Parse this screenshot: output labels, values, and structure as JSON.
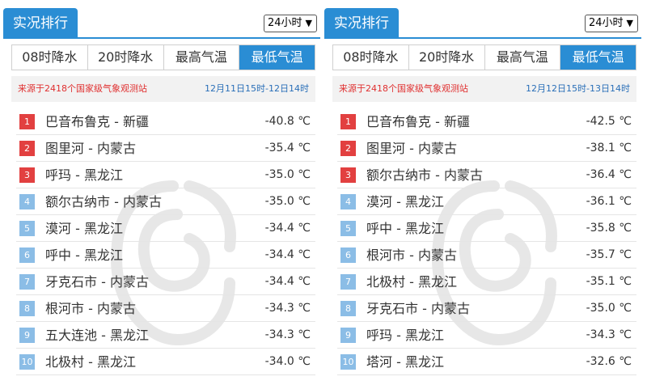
{
  "panels": [
    {
      "title": "实况排行",
      "hour_select": "24小时",
      "tabs": [
        "08时降水",
        "20时降水",
        "最高气温",
        "最低气温"
      ],
      "active_tab": 3,
      "source": "来源于2418个国家级气象观测站",
      "period": "12月11日15时-12日14时",
      "rows": [
        {
          "rank": "1",
          "station": "巴音布鲁克 - 新疆",
          "temp": "-40.8 ℃"
        },
        {
          "rank": "2",
          "station": "图里河 - 内蒙古",
          "temp": "-35.4 ℃"
        },
        {
          "rank": "3",
          "station": "呼玛 - 黑龙江",
          "temp": "-35.0 ℃"
        },
        {
          "rank": "4",
          "station": "额尔古纳市 - 内蒙古",
          "temp": "-35.0 ℃"
        },
        {
          "rank": "5",
          "station": "漠河 - 黑龙江",
          "temp": "-34.4 ℃"
        },
        {
          "rank": "6",
          "station": "呼中 - 黑龙江",
          "temp": "-34.4 ℃"
        },
        {
          "rank": "7",
          "station": "牙克石市 - 内蒙古",
          "temp": "-34.4 ℃"
        },
        {
          "rank": "8",
          "station": "根河市 - 内蒙古",
          "temp": "-34.3 ℃"
        },
        {
          "rank": "9",
          "station": "五大连池 - 黑龙江",
          "temp": "-34.3 ℃"
        },
        {
          "rank": "10",
          "station": "北极村 - 黑龙江",
          "temp": "-34.0 ℃"
        }
      ]
    },
    {
      "title": "实况排行",
      "hour_select": "24小时",
      "tabs": [
        "08时降水",
        "20时降水",
        "最高气温",
        "最低气温"
      ],
      "active_tab": 3,
      "source": "来源于2418个国家级气象观测站",
      "period": "12月12日15时-13日14时",
      "rows": [
        {
          "rank": "1",
          "station": "巴音布鲁克 - 新疆",
          "temp": "-42.5 ℃"
        },
        {
          "rank": "2",
          "station": "图里河 - 内蒙古",
          "temp": "-38.1 ℃"
        },
        {
          "rank": "3",
          "station": "额尔古纳市 - 内蒙古",
          "temp": "-36.4 ℃"
        },
        {
          "rank": "4",
          "station": "漠河 - 黑龙江",
          "temp": "-36.1 ℃"
        },
        {
          "rank": "5",
          "station": "呼中 - 黑龙江",
          "temp": "-35.8 ℃"
        },
        {
          "rank": "6",
          "station": "根河市 - 内蒙古",
          "temp": "-35.7 ℃"
        },
        {
          "rank": "7",
          "station": "北极村 - 黑龙江",
          "temp": "-35.1 ℃"
        },
        {
          "rank": "8",
          "station": "牙克石市 - 内蒙古",
          "temp": "-35.0 ℃"
        },
        {
          "rank": "9",
          "station": "呼玛 - 黑龙江",
          "temp": "-34.3 ℃"
        },
        {
          "rank": "10",
          "station": "塔河 - 黑龙江",
          "temp": "-32.6 ℃"
        }
      ]
    }
  ],
  "colors": {
    "accent": "#2a8dd4",
    "top_rank": "#e24040",
    "rank": "#8bbde6",
    "source_text": "#e03030",
    "period_text": "#2a6fb8"
  },
  "icons": {
    "watermark": "weather-logo-watermark",
    "select_chevron": "chevron-down-icon"
  }
}
